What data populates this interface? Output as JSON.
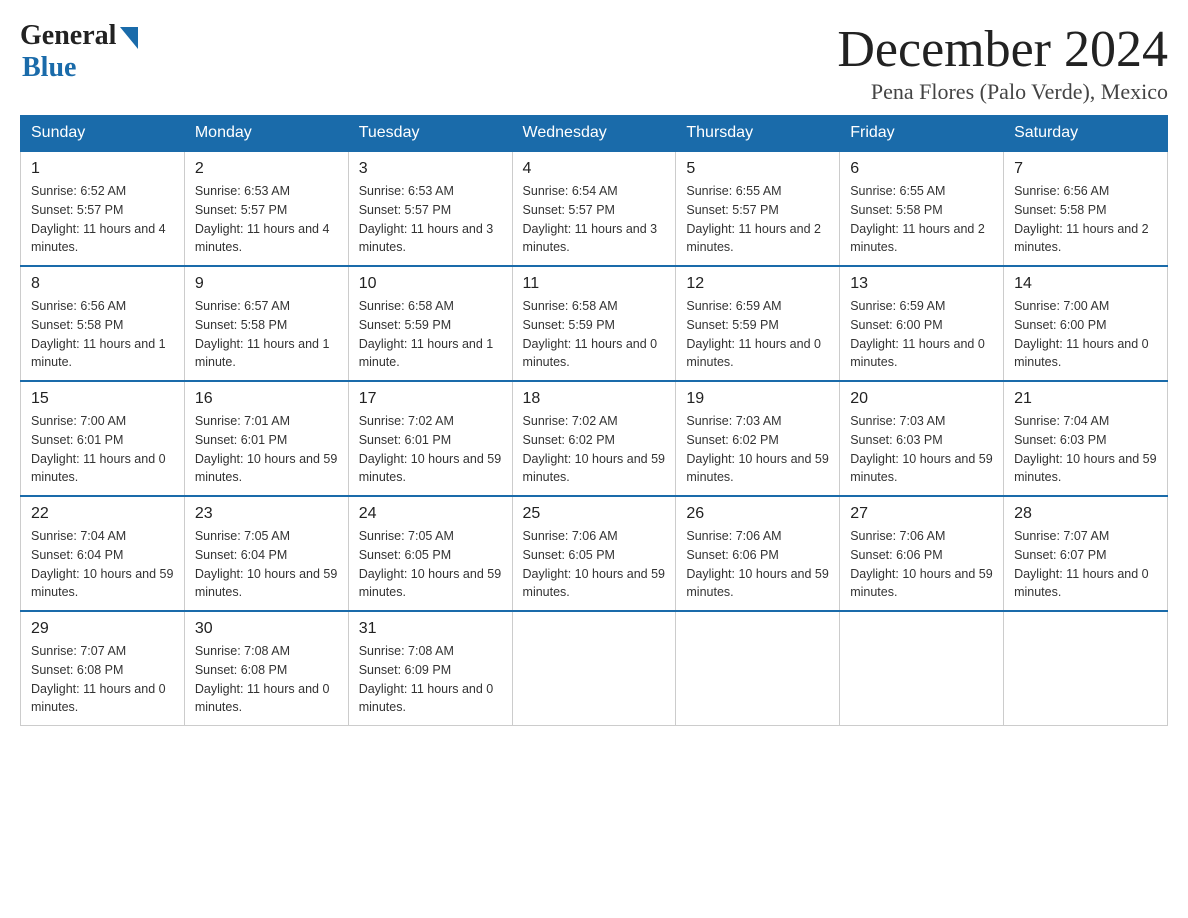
{
  "logo": {
    "general": "General",
    "blue": "Blue"
  },
  "title": "December 2024",
  "subtitle": "Pena Flores (Palo Verde), Mexico",
  "days_of_week": [
    "Sunday",
    "Monday",
    "Tuesday",
    "Wednesday",
    "Thursday",
    "Friday",
    "Saturday"
  ],
  "weeks": [
    [
      {
        "day": "1",
        "sunrise": "6:52 AM",
        "sunset": "5:57 PM",
        "daylight": "11 hours and 4 minutes."
      },
      {
        "day": "2",
        "sunrise": "6:53 AM",
        "sunset": "5:57 PM",
        "daylight": "11 hours and 4 minutes."
      },
      {
        "day": "3",
        "sunrise": "6:53 AM",
        "sunset": "5:57 PM",
        "daylight": "11 hours and 3 minutes."
      },
      {
        "day": "4",
        "sunrise": "6:54 AM",
        "sunset": "5:57 PM",
        "daylight": "11 hours and 3 minutes."
      },
      {
        "day": "5",
        "sunrise": "6:55 AM",
        "sunset": "5:57 PM",
        "daylight": "11 hours and 2 minutes."
      },
      {
        "day": "6",
        "sunrise": "6:55 AM",
        "sunset": "5:58 PM",
        "daylight": "11 hours and 2 minutes."
      },
      {
        "day": "7",
        "sunrise": "6:56 AM",
        "sunset": "5:58 PM",
        "daylight": "11 hours and 2 minutes."
      }
    ],
    [
      {
        "day": "8",
        "sunrise": "6:56 AM",
        "sunset": "5:58 PM",
        "daylight": "11 hours and 1 minute."
      },
      {
        "day": "9",
        "sunrise": "6:57 AM",
        "sunset": "5:58 PM",
        "daylight": "11 hours and 1 minute."
      },
      {
        "day": "10",
        "sunrise": "6:58 AM",
        "sunset": "5:59 PM",
        "daylight": "11 hours and 1 minute."
      },
      {
        "day": "11",
        "sunrise": "6:58 AM",
        "sunset": "5:59 PM",
        "daylight": "11 hours and 0 minutes."
      },
      {
        "day": "12",
        "sunrise": "6:59 AM",
        "sunset": "5:59 PM",
        "daylight": "11 hours and 0 minutes."
      },
      {
        "day": "13",
        "sunrise": "6:59 AM",
        "sunset": "6:00 PM",
        "daylight": "11 hours and 0 minutes."
      },
      {
        "day": "14",
        "sunrise": "7:00 AM",
        "sunset": "6:00 PM",
        "daylight": "11 hours and 0 minutes."
      }
    ],
    [
      {
        "day": "15",
        "sunrise": "7:00 AM",
        "sunset": "6:01 PM",
        "daylight": "11 hours and 0 minutes."
      },
      {
        "day": "16",
        "sunrise": "7:01 AM",
        "sunset": "6:01 PM",
        "daylight": "10 hours and 59 minutes."
      },
      {
        "day": "17",
        "sunrise": "7:02 AM",
        "sunset": "6:01 PM",
        "daylight": "10 hours and 59 minutes."
      },
      {
        "day": "18",
        "sunrise": "7:02 AM",
        "sunset": "6:02 PM",
        "daylight": "10 hours and 59 minutes."
      },
      {
        "day": "19",
        "sunrise": "7:03 AM",
        "sunset": "6:02 PM",
        "daylight": "10 hours and 59 minutes."
      },
      {
        "day": "20",
        "sunrise": "7:03 AM",
        "sunset": "6:03 PM",
        "daylight": "10 hours and 59 minutes."
      },
      {
        "day": "21",
        "sunrise": "7:04 AM",
        "sunset": "6:03 PM",
        "daylight": "10 hours and 59 minutes."
      }
    ],
    [
      {
        "day": "22",
        "sunrise": "7:04 AM",
        "sunset": "6:04 PM",
        "daylight": "10 hours and 59 minutes."
      },
      {
        "day": "23",
        "sunrise": "7:05 AM",
        "sunset": "6:04 PM",
        "daylight": "10 hours and 59 minutes."
      },
      {
        "day": "24",
        "sunrise": "7:05 AM",
        "sunset": "6:05 PM",
        "daylight": "10 hours and 59 minutes."
      },
      {
        "day": "25",
        "sunrise": "7:06 AM",
        "sunset": "6:05 PM",
        "daylight": "10 hours and 59 minutes."
      },
      {
        "day": "26",
        "sunrise": "7:06 AM",
        "sunset": "6:06 PM",
        "daylight": "10 hours and 59 minutes."
      },
      {
        "day": "27",
        "sunrise": "7:06 AM",
        "sunset": "6:06 PM",
        "daylight": "10 hours and 59 minutes."
      },
      {
        "day": "28",
        "sunrise": "7:07 AM",
        "sunset": "6:07 PM",
        "daylight": "11 hours and 0 minutes."
      }
    ],
    [
      {
        "day": "29",
        "sunrise": "7:07 AM",
        "sunset": "6:08 PM",
        "daylight": "11 hours and 0 minutes."
      },
      {
        "day": "30",
        "sunrise": "7:08 AM",
        "sunset": "6:08 PM",
        "daylight": "11 hours and 0 minutes."
      },
      {
        "day": "31",
        "sunrise": "7:08 AM",
        "sunset": "6:09 PM",
        "daylight": "11 hours and 0 minutes."
      },
      null,
      null,
      null,
      null
    ]
  ]
}
